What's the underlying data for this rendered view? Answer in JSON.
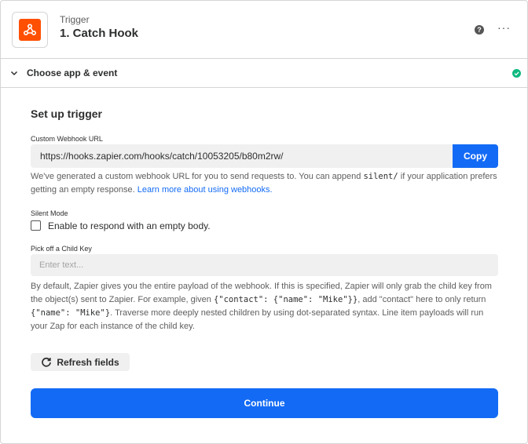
{
  "header": {
    "step_kind": "Trigger",
    "step_title": "1. Catch Hook",
    "help": "?",
    "more": "···",
    "app_icon": "webhook-icon",
    "brand_color": "#ff4f00"
  },
  "section": {
    "label": "Choose app & event",
    "status_icon": "check-circle-icon",
    "status_color": "#10b981"
  },
  "setup": {
    "title": "Set up trigger",
    "webhook": {
      "label": "Custom Webhook URL",
      "url": "https://hooks.zapier.com/hooks/catch/10053205/b80m2rw/",
      "copy_label": "Copy",
      "help_part1": "We've generated a custom webhook URL for you to send requests to. You can append ",
      "help_code": "silent/",
      "help_part2": " if your application prefers getting an empty response. ",
      "help_link": "Learn more about using webhooks."
    },
    "silent": {
      "label": "Silent Mode",
      "checkbox_label": "Enable to respond with an empty body."
    },
    "child_key": {
      "label": "Pick off a Child Key",
      "placeholder": "Enter text...",
      "help_part1": "By default, Zapier gives you the entire payload of the webhook. If this is specified, Zapier will only grab the child key from the object(s) sent to Zapier. For example, given ",
      "help_code1": "{\"contact\": {\"name\": \"Mike\"}}",
      "help_part2": ", add \"contact\" here to only return ",
      "help_code2": "{\"name\": \"Mike\"}",
      "help_part3": ". Traverse more deeply nested children by using dot-separated syntax. Line item payloads will run your Zap for each instance of the child key."
    },
    "refresh_label": "Refresh fields",
    "continue_label": "Continue",
    "accent_color": "#136bf5"
  }
}
